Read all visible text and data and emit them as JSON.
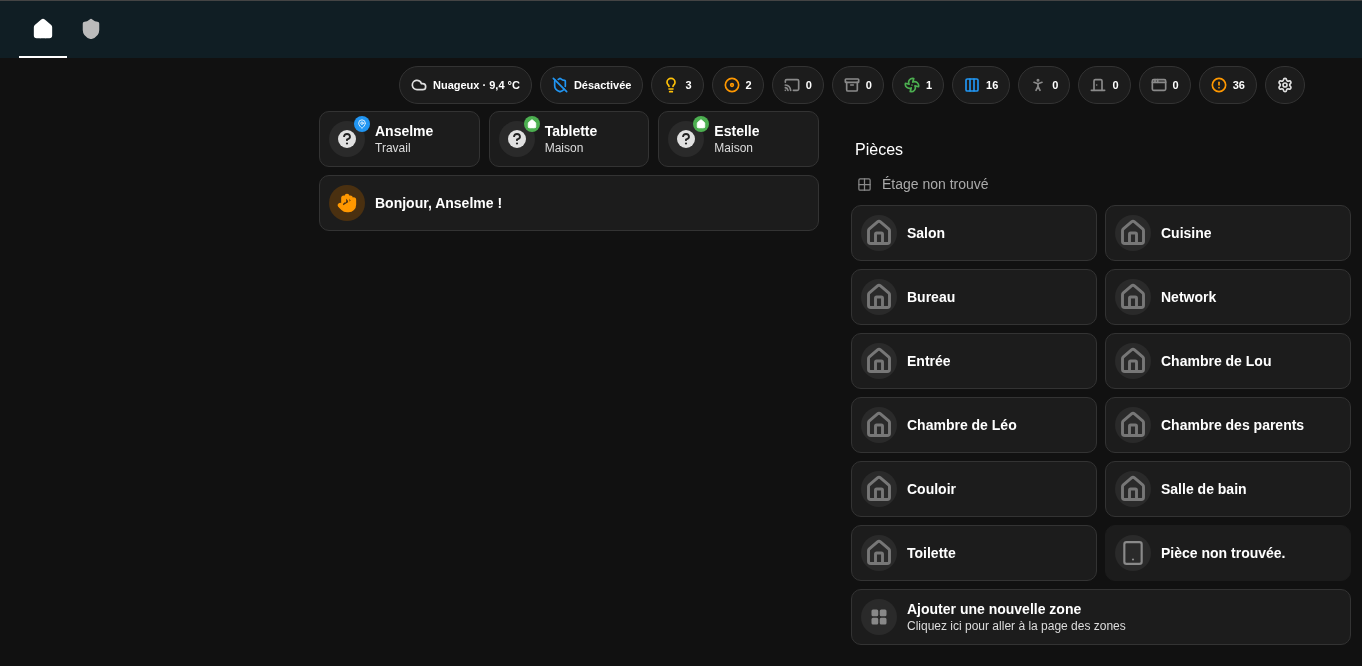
{
  "tabs": [
    {
      "kind": "home",
      "selected": true
    },
    {
      "kind": "shield",
      "selected": false
    }
  ],
  "chips": [
    {
      "kind": "cloud",
      "label": "Nuageux · 9,4 °C"
    },
    {
      "kind": "shield-off",
      "label": "Désactivée"
    },
    {
      "kind": "light",
      "label": "3"
    },
    {
      "kind": "media",
      "label": "2"
    },
    {
      "kind": "cast",
      "label": "0"
    },
    {
      "kind": "cabinet",
      "label": "0"
    },
    {
      "kind": "fan",
      "label": "1"
    },
    {
      "kind": "blinds",
      "label": "16"
    },
    {
      "kind": "motion",
      "label": "0"
    },
    {
      "kind": "door",
      "label": "0"
    },
    {
      "kind": "window",
      "label": "0"
    },
    {
      "kind": "alert",
      "label": "36"
    },
    {
      "kind": "settings"
    }
  ],
  "persons": [
    {
      "name": "Anselme",
      "state": "Travail",
      "kind": "location",
      "color": "#2196f3"
    },
    {
      "name": "Tablette",
      "state": "Maison",
      "kind": "home",
      "color": "#4caf50"
    },
    {
      "name": "Estelle",
      "state": "Maison",
      "kind": "home",
      "color": "#4caf50"
    }
  ],
  "greeting": "Bonjour, Anselme !",
  "rooms_section": {
    "title": "Pièces",
    "floor": "Étage non trouvé",
    "rooms": [
      {
        "kind": "room",
        "name": "Salon"
      },
      {
        "kind": "room",
        "name": "Cuisine"
      },
      {
        "kind": "room",
        "name": "Bureau"
      },
      {
        "kind": "room",
        "name": "Network"
      },
      {
        "kind": "room",
        "name": "Entrée"
      },
      {
        "kind": "room",
        "name": "Chambre de Lou"
      },
      {
        "kind": "room",
        "name": "Chambre de Léo"
      },
      {
        "kind": "room",
        "name": "Chambre des parents"
      },
      {
        "kind": "room",
        "name": "Couloir"
      },
      {
        "kind": "room",
        "name": "Salle de bain"
      },
      {
        "kind": "room",
        "name": "Toilette"
      },
      {
        "kind": "missing",
        "name": "Pièce non trouvée."
      }
    ],
    "add_zone": {
      "title": "Ajouter une nouvelle zone",
      "subtitle": "Cliquez ici pour aller à la page des zones"
    }
  }
}
